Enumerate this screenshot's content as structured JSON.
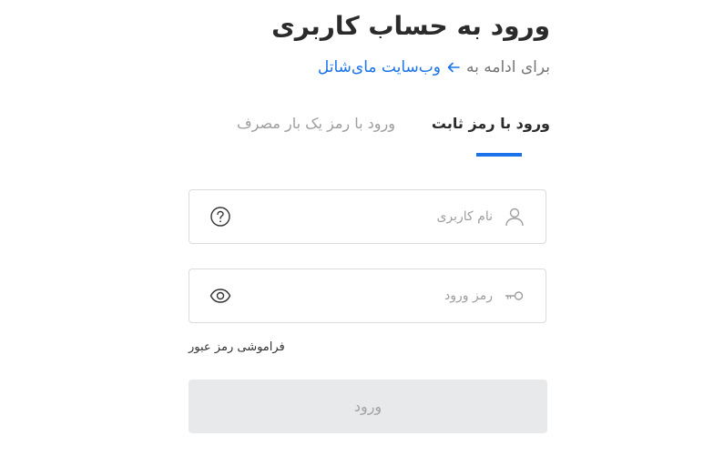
{
  "header": {
    "title": "ورود به حساب کاربری",
    "subtitle_prefix": "برای ادامه به",
    "subtitle_link": "وب‌سایت مای‌شاتل"
  },
  "tabs": [
    {
      "label": "ورود با رمز ثابت",
      "active": true
    },
    {
      "label": "ورود با رمز یک بار مصرف",
      "active": false
    }
  ],
  "form": {
    "username": {
      "placeholder": "نام کاربری",
      "value": ""
    },
    "password": {
      "placeholder": "رمز ورود",
      "value": ""
    },
    "forgot_label": "فراموشی رمز عبور",
    "submit_label": "ورود"
  },
  "colors": {
    "accent": "#1a73e8",
    "disabled_bg": "#e8e9ea",
    "disabled_text": "#a4a4a4"
  },
  "icons": {
    "username_lead": "user-icon",
    "username_trail": "help-icon",
    "password_lead": "key-icon",
    "password_trail": "eye-icon",
    "subtitle_arrow": "arrow-left-icon"
  }
}
